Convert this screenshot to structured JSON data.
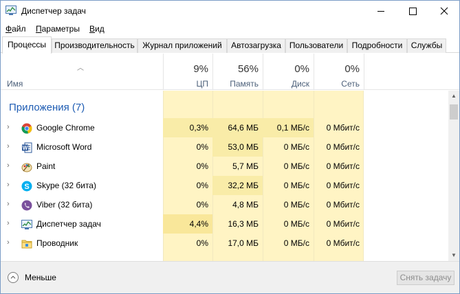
{
  "window": {
    "title": "Диспетчер задач"
  },
  "menu": [
    {
      "accel": "Ф",
      "rest": "айл"
    },
    {
      "accel": "П",
      "rest": "араметры"
    },
    {
      "accel": "В",
      "rest": "ид"
    }
  ],
  "tabs": [
    "Процессы",
    "Производительность",
    "Журнал приложений",
    "Автозагрузка",
    "Пользователи",
    "Подробности",
    "Службы"
  ],
  "active_tab": "Процессы",
  "columns": {
    "name": "Имя",
    "cpu": {
      "pct": "9%",
      "label": "ЦП"
    },
    "memory": {
      "pct": "56%",
      "label": "Память"
    },
    "disk": {
      "pct": "0%",
      "label": "Диск"
    },
    "network": {
      "pct": "0%",
      "label": "Сеть"
    }
  },
  "group": {
    "title": "Приложения (7)"
  },
  "rows": [
    {
      "name": "Google Chrome",
      "icon": "chrome-icon",
      "cpu": "0,3%",
      "mem": "64,6 МБ",
      "disk": "0,1 МБ/с",
      "net": "0 Мбит/с"
    },
    {
      "name": "Microsoft Word",
      "icon": "word-icon",
      "cpu": "0%",
      "mem": "53,0 МБ",
      "disk": "0 МБ/с",
      "net": "0 Мбит/с"
    },
    {
      "name": "Paint",
      "icon": "paint-icon",
      "cpu": "0%",
      "mem": "5,7 МБ",
      "disk": "0 МБ/с",
      "net": "0 Мбит/с"
    },
    {
      "name": "Skype (32 бита)",
      "icon": "skype-icon",
      "cpu": "0%",
      "mem": "32,2 МБ",
      "disk": "0 МБ/с",
      "net": "0 Мбит/с"
    },
    {
      "name": "Viber (32 бита)",
      "icon": "viber-icon",
      "cpu": "0%",
      "mem": "4,8 МБ",
      "disk": "0 МБ/с",
      "net": "0 Мбит/с"
    },
    {
      "name": "Диспетчер задач",
      "icon": "task-manager-icon",
      "cpu": "4,4%",
      "mem": "16,3 МБ",
      "disk": "0 МБ/с",
      "net": "0 Мбит/с"
    },
    {
      "name": "Проводник",
      "icon": "explorer-icon",
      "cpu": "0%",
      "mem": "17,0 МБ",
      "disk": "0 МБ/с",
      "net": "0 Мбит/с"
    }
  ],
  "footer": {
    "fewer_label": "Меньше",
    "end_task_label": "Снять задачу"
  },
  "colors": {
    "heat_light": "#fff4c4",
    "heat_medium": "#f9eca8",
    "group_blue": "#1e5cb3"
  }
}
